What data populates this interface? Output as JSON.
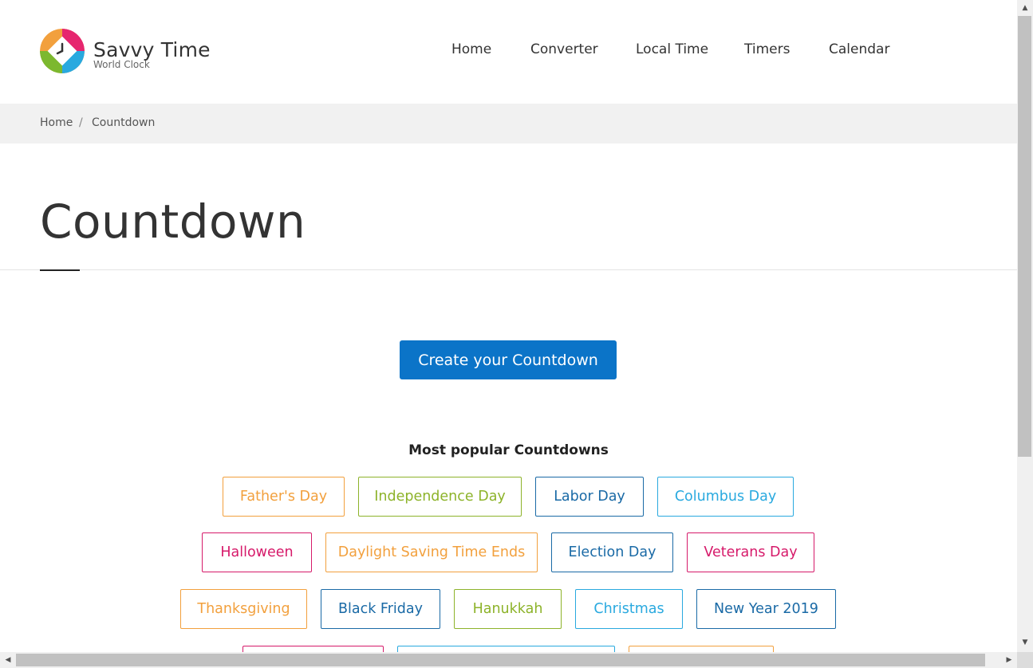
{
  "header": {
    "brand_name": "Savvy Time",
    "brand_sub": "World Clock",
    "logo_icon": "clock-icon",
    "nav": [
      "Home",
      "Converter",
      "Local Time",
      "Timers",
      "Calendar"
    ]
  },
  "breadcrumb": {
    "home": "Home",
    "separator": "/",
    "current": "Countdown"
  },
  "page": {
    "title": "Countdown",
    "create_button": "Create your Countdown",
    "popular_title": "Most popular Countdowns"
  },
  "popular": [
    {
      "label": "Father's Day",
      "color": "#f2a03d"
    },
    {
      "label": "Independence Day",
      "color": "#8db32a"
    },
    {
      "label": "Labor Day",
      "color": "#1a6aa6"
    },
    {
      "label": "Columbus Day",
      "color": "#29a9df"
    },
    {
      "label": "Halloween",
      "color": "#d61a6a"
    },
    {
      "label": "Daylight Saving Time Ends",
      "color": "#f2a03d"
    },
    {
      "label": "Election Day",
      "color": "#1a6aa6"
    },
    {
      "label": "Veterans Day",
      "color": "#d61a6a"
    },
    {
      "label": "Thanksgiving",
      "color": "#f2a03d"
    },
    {
      "label": "Black Friday",
      "color": "#1a6aa6"
    },
    {
      "label": "Hanukkah",
      "color": "#8db32a"
    },
    {
      "label": "Christmas",
      "color": "#29a9df"
    },
    {
      "label": "New Year 2019",
      "color": "#1a6aa6"
    },
    {
      "label": "",
      "color": "#d61a6a"
    },
    {
      "label": "",
      "color": "#29a9df"
    },
    {
      "label": "",
      "color": "#f2a03d"
    }
  ],
  "colors": {
    "accent": "#0b74c8",
    "breadcrumb_bg": "#f1f1f1"
  }
}
